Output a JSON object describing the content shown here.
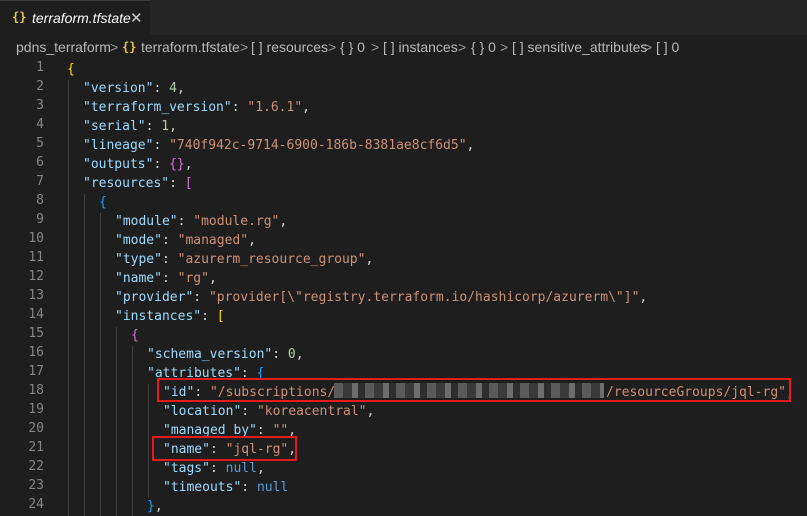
{
  "tab": {
    "icon": "json-braces-icon",
    "braces": "{}",
    "title": "terraform.tfstate",
    "close": "✕"
  },
  "breadcrumb": {
    "folder": "pdns_terraform",
    "file_icon": "{}",
    "file": "terraform.tfstate",
    "items": [
      "[ ] resources",
      "{ } 0",
      "[ ] instances",
      "{ } 0",
      "[ ] sensitive_attributes",
      "[ ] 0"
    ],
    "separator": ">"
  },
  "line_numbers": [
    "1",
    "2",
    "3",
    "4",
    "5",
    "6",
    "7",
    "8",
    "9",
    "10",
    "11",
    "12",
    "13",
    "14",
    "15",
    "16",
    "17",
    "18",
    "19",
    "20",
    "21",
    "22",
    "23",
    "24"
  ],
  "code": {
    "l1": "{",
    "version_key": "\"version\"",
    "version_val": "4",
    "tfver_key": "\"terraform_version\"",
    "tfver_val": "\"1.6.1\"",
    "serial_key": "\"serial\"",
    "serial_val": "1",
    "lineage_key": "\"lineage\"",
    "lineage_val": "\"740f942c-9714-6900-186b-8381ae8cf6d5\"",
    "outputs_key": "\"outputs\"",
    "outputs_val": "{}",
    "resources_key": "\"resources\"",
    "resources_open": "[",
    "obj_open": "{",
    "module_key": "\"module\"",
    "module_val": "\"module.rg\"",
    "mode_key": "\"mode\"",
    "mode_val": "\"managed\"",
    "type_key": "\"type\"",
    "type_val": "\"azurerm_resource_group\"",
    "name_key": "\"name\"",
    "name_val": "\"rg\"",
    "provider_key": "\"provider\"",
    "provider_val": "\"provider[\\\"registry.terraform.io/hashicorp/azurerm\\\"]\"",
    "instances_key": "\"instances\"",
    "instances_open": "[",
    "inst_open": "{",
    "schema_key": "\"schema_version\"",
    "schema_val": "0",
    "attributes_key": "\"attributes\"",
    "attributes_open": "{",
    "id_key": "\"id\"",
    "id_val_start": "\"/subscriptions/",
    "id_val_end": "/resourceGroups/jql-rg\"",
    "location_key": "\"location\"",
    "location_val": "\"koreacentral\"",
    "managed_by_key": "\"managed_by\"",
    "managed_by_val": "\"\"",
    "attr_name_key": "\"name\"",
    "attr_name_val": "\"jql-rg\"",
    "tags_key": "\"tags\"",
    "tags_val": "null",
    "timeouts_key": "\"timeouts\"",
    "timeouts_val": "null",
    "close_brace": "}"
  },
  "colors": {
    "key": "#9cdcfe",
    "string": "#ce9178",
    "number": "#b5cea8",
    "highlight": "#e41b1b"
  }
}
